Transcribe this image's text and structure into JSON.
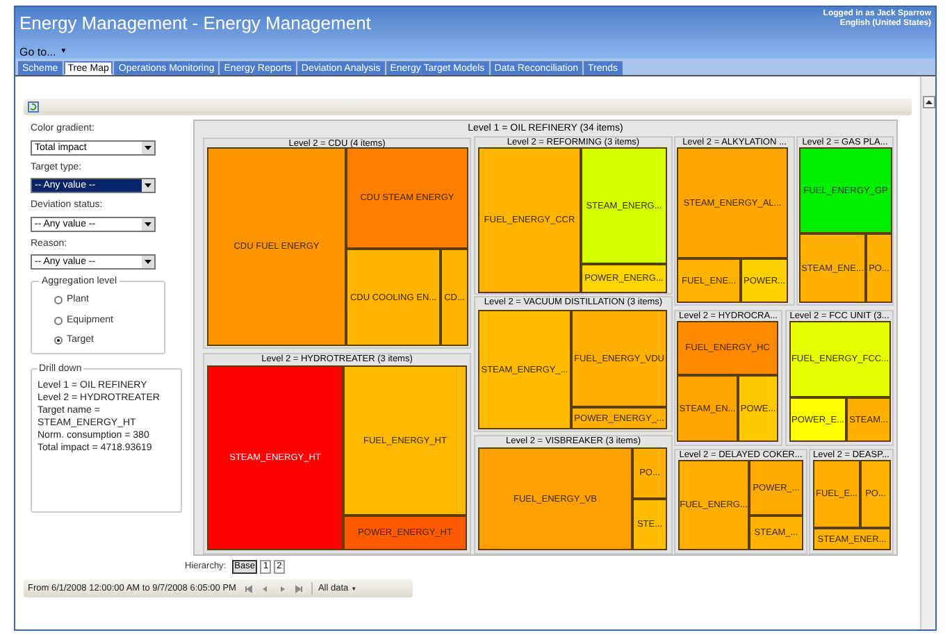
{
  "window": {
    "title": "Energy Management - Energy Management",
    "user": "Logged in as Jack Sparrow",
    "language": "English (United States)"
  },
  "menu": {
    "label": "Go to...",
    "caret": "▼"
  },
  "tabs": [
    {
      "label": "Scheme",
      "selected": false
    },
    {
      "label": "Tree Map",
      "selected": true
    },
    {
      "label": "Operations Monitoring",
      "selected": false
    },
    {
      "label": "Energy Reports",
      "selected": false
    },
    {
      "label": "Deviation Analysis",
      "selected": false
    },
    {
      "label": "Energy Target Models",
      "selected": false
    },
    {
      "label": "Data Reconciliation",
      "selected": false
    },
    {
      "label": "Trends",
      "selected": false
    }
  ],
  "filters": [
    {
      "label": "Color gradient:",
      "value": "Total impact",
      "highlighted": false
    },
    {
      "label": "Target type:",
      "value": "-- Any value --",
      "highlighted": true
    },
    {
      "label": "Deviation status:",
      "value": "-- Any value --",
      "highlighted": false
    },
    {
      "label": "Reason:",
      "value": "-- Any value --",
      "highlighted": false
    }
  ],
  "aggregation": {
    "title": "Aggregation level",
    "options": [
      {
        "label": "Plant",
        "selected": false
      },
      {
        "label": "Equipment",
        "selected": false
      },
      {
        "label": "Target",
        "selected": true
      }
    ]
  },
  "drill_down": {
    "title": "Drill down",
    "lines": [
      "Level 1 = OIL REFINERY",
      "Level 2 = HYDROTREATER",
      "Target name =",
      "STEAM_ENERGY_HT",
      "Norm. consumption = 380",
      "Total impact = 4718.93619"
    ]
  },
  "treemap": {
    "title": "Level 1 = OIL REFINERY (34 items)",
    "groups": [
      {
        "title": "Level 2 = CDU (4 items)",
        "tiles": [
          {
            "label": "CDU FUEL ENERGY",
            "color": "#ff9400"
          },
          {
            "label": "CDU STEAM ENERGY",
            "color": "#ff8000"
          },
          {
            "label": "CDU COOLING EN...",
            "color": "#ffb400"
          },
          {
            "label": "CD...",
            "color": "#ffb400"
          }
        ]
      },
      {
        "title": "Level 2 = HYDROTREATER (3 items)",
        "tiles": [
          {
            "label": "STEAM_ENERGY_HT",
            "color": "#ff0000"
          },
          {
            "label": "FUEL_ENERGY_HT",
            "color": "#ffb800"
          },
          {
            "label": "POWER_ENERGY_HT",
            "color": "#ff5a00"
          }
        ]
      },
      {
        "title": "Level 2 = REFORMING (3 items)",
        "tiles": [
          {
            "label": "FUEL_ENERGY_CCR",
            "color": "#ffb400"
          },
          {
            "label": "STEAM_ENERG...",
            "color": "#d4ff00"
          },
          {
            "label": "POWER_ENERG...",
            "color": "#ffd500"
          }
        ]
      },
      {
        "title": "Level 2 = VACUUM DISTILLATION (3 items)",
        "tiles": [
          {
            "label": "STEAM_ENERGY_...",
            "color": "#ffbb00"
          },
          {
            "label": "FUEL_ENERGY_VDU",
            "color": "#ffb000"
          },
          {
            "label": "POWER_ENERGY_...",
            "color": "#ffb000"
          }
        ]
      },
      {
        "title": "Level 2 = VISBREAKER (3 items)",
        "tiles": [
          {
            "label": "FUEL_ENERGY_VB",
            "color": "#ffa000"
          },
          {
            "label": "PO...",
            "color": "#ffb000"
          },
          {
            "label": "STE...",
            "color": "#ffbc00"
          }
        ]
      },
      {
        "title": "Level 2 = ALKYLATION ...",
        "tiles": [
          {
            "label": "STEAM_ENERGY_AL...",
            "color": "#ffa500"
          },
          {
            "label": "FUEL_ENE...",
            "color": "#ffb300"
          },
          {
            "label": "POWER...",
            "color": "#ffd000"
          }
        ]
      },
      {
        "title": "Level 2 = GAS PLA...",
        "tiles": [
          {
            "label": "FUEL_ENERGY_GP",
            "color": "#00ee00"
          },
          {
            "label": "STEAM_ENE...",
            "color": "#ffb000"
          },
          {
            "label": "PO...",
            "color": "#ffb000"
          }
        ]
      },
      {
        "title": "Level 2 = HYDROCRA...",
        "tiles": [
          {
            "label": "FUEL_ENERGY_HC",
            "color": "#ff8a00"
          },
          {
            "label": "STEAM_EN...",
            "color": "#ffa500"
          },
          {
            "label": "POWE...",
            "color": "#ffc800"
          }
        ]
      },
      {
        "title": "Level 2 = FCC UNIT (3...",
        "tiles": [
          {
            "label": "FUEL_ENERGY_FCC...",
            "color": "#e6ff00"
          },
          {
            "label": "POWER_E...",
            "color": "#ffff00"
          },
          {
            "label": "STEAM...",
            "color": "#ffb000"
          }
        ]
      },
      {
        "title": "Level 2 = DELAYED COKER...",
        "tiles": [
          {
            "label": "FUEL_ENERG...",
            "color": "#ffad00"
          },
          {
            "label": "POWER_...",
            "color": "#ffaa00"
          },
          {
            "label": "STEAM_...",
            "color": "#ffb300"
          }
        ]
      },
      {
        "title": "Level 2 = DEASP...",
        "tiles": [
          {
            "label": "FUEL_E...",
            "color": "#ffae00"
          },
          {
            "label": "PO...",
            "color": "#ffb300"
          },
          {
            "label": "STEAM_ENER...",
            "color": "#ffb300"
          }
        ]
      }
    ]
  },
  "hierarchy": {
    "label": "Hierarchy:",
    "levels": [
      {
        "label": "Base",
        "selected": true
      },
      {
        "label": "1",
        "selected": false
      },
      {
        "label": "2",
        "selected": false
      }
    ]
  },
  "status_bar": {
    "range": "From 6/1/2008 12:00:00 AM to 9/7/2008 6:05:00 PM",
    "filter": "All data",
    "caret": "▼"
  }
}
